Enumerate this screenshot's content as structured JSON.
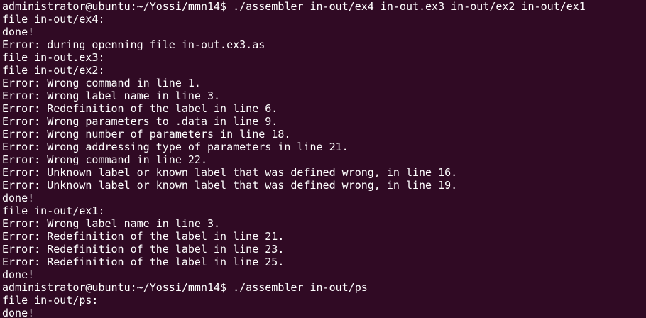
{
  "terminal": {
    "lines": [
      "administrator@ubuntu:~/Yossi/mmn14$ ./assembler in-out/ex4 in-out.ex3 in-out/ex2 in-out/ex1",
      "file in-out/ex4:",
      "done!",
      "Error: during openning file in-out.ex3.as",
      "file in-out.ex3:",
      "file in-out/ex2:",
      "Error: Wrong command in line 1.",
      "Error: Wrong label name in line 3.",
      "Error: Redefinition of the label in line 6.",
      "Error: Wrong parameters to .data in line 9.",
      "Error: Wrong number of parameters in line 18.",
      "Error: Wrong addressing type of parameters in line 21.",
      "Error: Wrong command in line 22.",
      "Error: Unknown label or known label that was defined wrong, in line 16.",
      "Error: Unknown label or known label that was defined wrong, in line 19.",
      "done!",
      "file in-out/ex1:",
      "Error: Wrong label name in line 3.",
      "Error: Redefinition of the label in line 21.",
      "Error: Redefinition of the label in line 23.",
      "Error: Redefinition of the label in line 25.",
      "done!",
      "administrator@ubuntu:~/Yossi/mmn14$ ./assembler in-out/ps",
      "file in-out/ps:",
      "done!"
    ]
  },
  "colors": {
    "background": "#300a24",
    "text": "#ffffff"
  }
}
